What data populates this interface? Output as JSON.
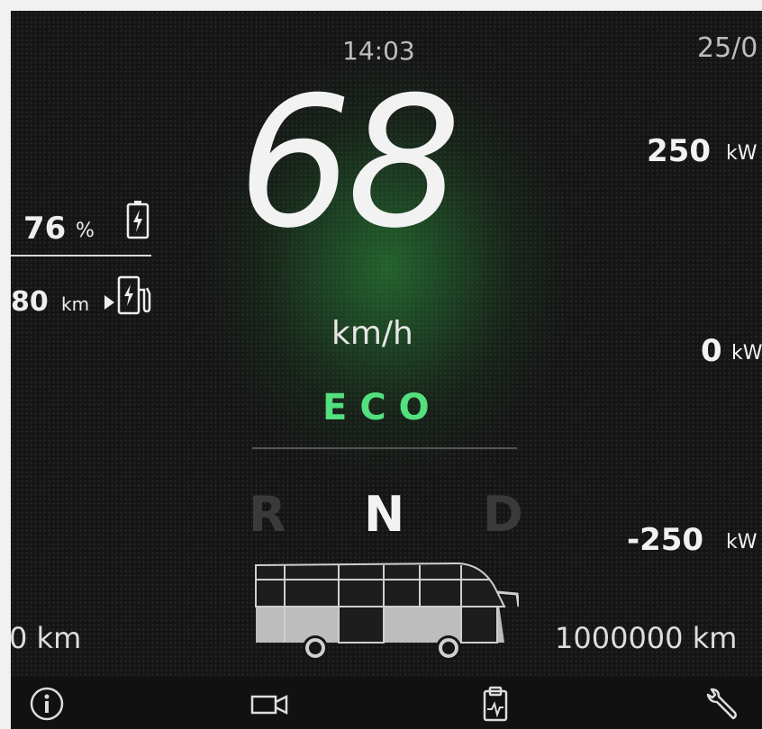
{
  "header": {
    "time": "14:03",
    "date": "25/0"
  },
  "speedometer": {
    "speed": "68",
    "unit": "km/h",
    "drive_mode": "ECO"
  },
  "gear_selector": {
    "reverse": "R",
    "neutral": "N",
    "drive": "D",
    "selected": "N"
  },
  "battery": {
    "charge_value": "76",
    "charge_unit": "%",
    "range_value": "80",
    "range_unit": "km"
  },
  "power_scale": {
    "top_value": "250",
    "top_unit": "kW",
    "mid_value": "0",
    "mid_unit": "kW",
    "bottom_value": "-250",
    "bottom_unit": "kW"
  },
  "odometer": {
    "trip": "0 km",
    "total": "1000000 km"
  },
  "bottom_bar": {
    "icons": [
      "info-icon",
      "camera-icon",
      "diagnostics-clipboard-icon",
      "wrench-icon"
    ]
  },
  "colors": {
    "eco_accent": "#53e07e",
    "background": "#151515",
    "glow": "#2ea040"
  }
}
